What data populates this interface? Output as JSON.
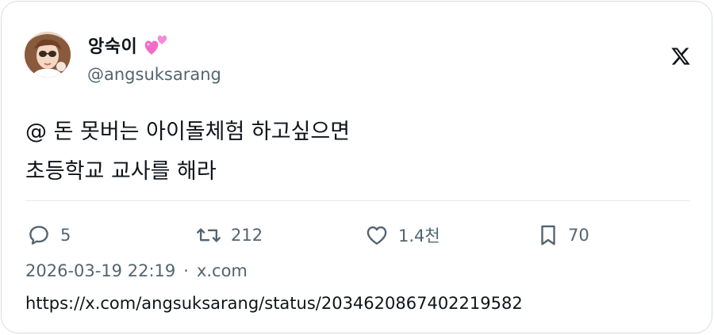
{
  "author": {
    "display_name": "앙숙이",
    "handle": "@angsuksarang",
    "name_emoji": "two-hearts-icon"
  },
  "platform_logo": "x-logo-icon",
  "tweet": {
    "lines": [
      "@ 돈 못버는 아이돌체험 하고싶으면",
      "초등학교 교사를 해라"
    ]
  },
  "actions": {
    "replies": "5",
    "reposts": "212",
    "likes": "1.4천",
    "bookmarks": "70"
  },
  "meta": {
    "timestamp": "2026-03-19 22:19",
    "separator": "·",
    "source": "x.com"
  },
  "url": "https://x.com/angsuksarang/status/2034620867402219582",
  "colors": {
    "text_primary": "#0f1419",
    "text_secondary": "#536471",
    "border": "#d9dde1",
    "heart_pink": "#f06cc8"
  }
}
